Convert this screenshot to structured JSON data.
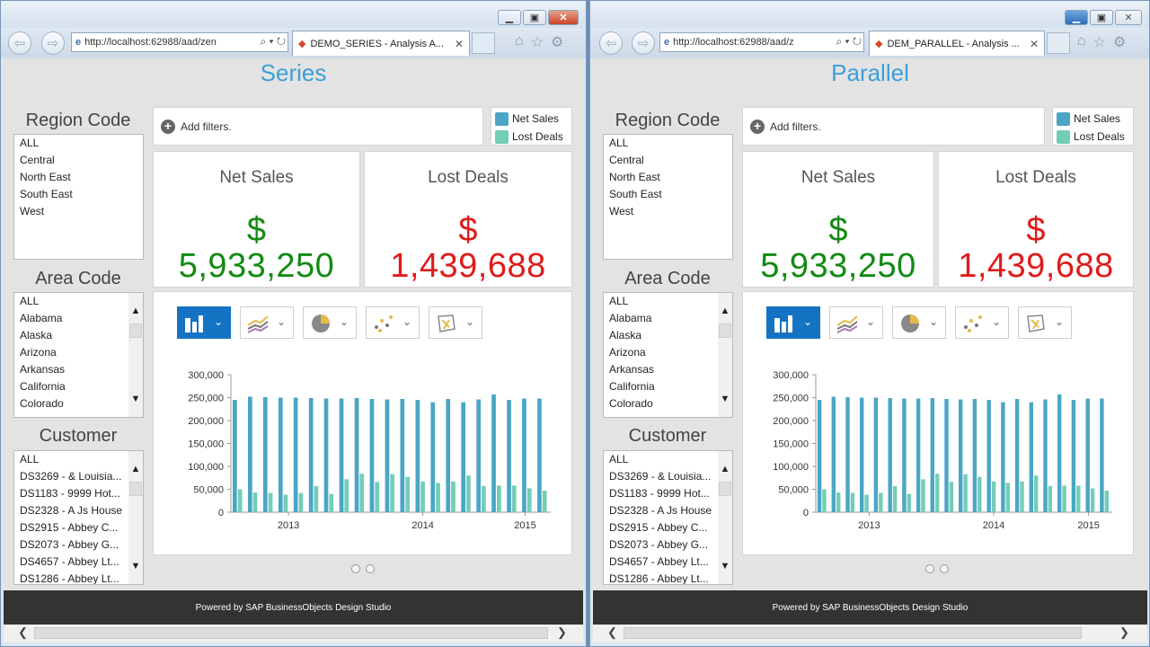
{
  "windows": {
    "left": {
      "address": "http://localhost:62988/aad/zen",
      "tab_title": "DEMO_SERIES - Analysis A...",
      "page_title": "Series"
    },
    "right": {
      "address": "http://localhost:62988/aad/z",
      "tab_title": "DEM_PARALLEL - Analysis ...",
      "page_title": "Parallel"
    }
  },
  "sidebar": {
    "region_heading": "Region Code",
    "region_items": [
      "ALL",
      "Central",
      "North East",
      "South East",
      "West"
    ],
    "area_heading": "Area Code",
    "area_items": [
      "ALL",
      "Alabama",
      "Alaska",
      "Arizona",
      "Arkansas",
      "California",
      "Colorado"
    ],
    "customer_heading": "Customer",
    "customer_items": [
      "ALL",
      "DS3269 - & Louisia...",
      "DS1183 - 9999 Hot...",
      "DS2328 - A Js House",
      "DS2915 - Abbey C...",
      "DS2073 - Abbey G...",
      "DS4657 - Abbey Lt...",
      "DS1286 - Abbey Lt..."
    ]
  },
  "filter": {
    "add_label": "Add filters."
  },
  "legend": {
    "items": [
      {
        "label": "Net Sales",
        "color": "#4aa6c4"
      },
      {
        "label": "Lost Deals",
        "color": "#73cdb7"
      }
    ]
  },
  "kpis": {
    "net_sales": {
      "title": "Net Sales",
      "currency": "$",
      "value": "5,933,250",
      "color": "#138a13"
    },
    "lost_deals": {
      "title": "Lost Deals",
      "currency": "$",
      "value": "1,439,688",
      "color": "#e01b1b"
    }
  },
  "chart_toolbar": {
    "icons": [
      "bar-chart-icon",
      "line-chart-icon",
      "pie-chart-icon",
      "scatter-chart-icon",
      "map-chart-icon"
    ]
  },
  "chart_data": {
    "type": "bar",
    "series": [
      {
        "name": "Net Sales",
        "color": "#4aa6c4",
        "values": [
          245000,
          252000,
          251000,
          250000,
          250000,
          249000,
          248000,
          248000,
          249000,
          247000,
          246000,
          247000,
          245000,
          240000,
          247000,
          240000,
          246000,
          257000,
          245000,
          248000,
          248000
        ]
      },
      {
        "name": "Lost Deals",
        "color": "#73cdb7",
        "values": [
          50000,
          43000,
          42000,
          38000,
          42000,
          57000,
          40000,
          72000,
          84000,
          66000,
          83000,
          77000,
          67000,
          64000,
          67000,
          80000,
          57000,
          58000,
          58000,
          52000,
          47000
        ]
      }
    ],
    "x_tick_labels": [
      "2013",
      "2014",
      "2015"
    ],
    "y_tick_labels": [
      "0",
      "50,000",
      "100,000",
      "150,000",
      "200,000",
      "250,000",
      "300,000"
    ],
    "ylim": [
      0,
      300000
    ]
  },
  "footer": {
    "text": "Powered by SAP BusinessObjects Design Studio"
  }
}
